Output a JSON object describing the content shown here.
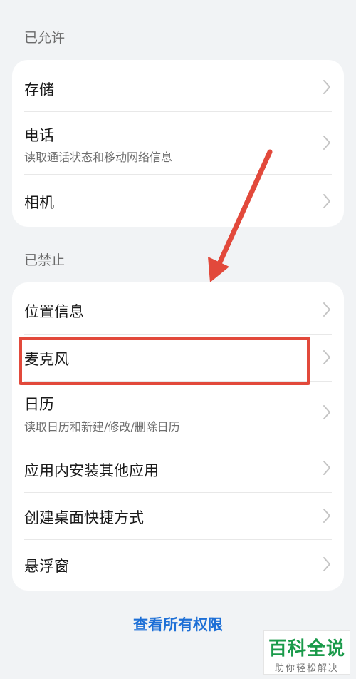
{
  "allowed": {
    "header": "已允许",
    "items": [
      {
        "title": "存储"
      },
      {
        "title": "电话",
        "subtitle": "读取通话状态和移动网络信息"
      },
      {
        "title": "相机"
      }
    ]
  },
  "denied": {
    "header": "已禁止",
    "items": [
      {
        "title": "位置信息"
      },
      {
        "title": "麦克风"
      },
      {
        "title": "日历",
        "subtitle": "读取日历和新建/修改/删除日历"
      },
      {
        "title": "应用内安装其他应用"
      },
      {
        "title": "创建桌面快捷方式"
      },
      {
        "title": "悬浮窗"
      }
    ]
  },
  "view_all_label": "查看所有权限",
  "watermark": {
    "main": "百科全说",
    "sub": "助你轻松解决"
  },
  "colors": {
    "accent_link": "#1d6fd6",
    "annotation_red": "#e2493b",
    "watermark_green": "#1a9a4a"
  },
  "icons": {
    "row_chevron": "chevron-right-icon"
  }
}
